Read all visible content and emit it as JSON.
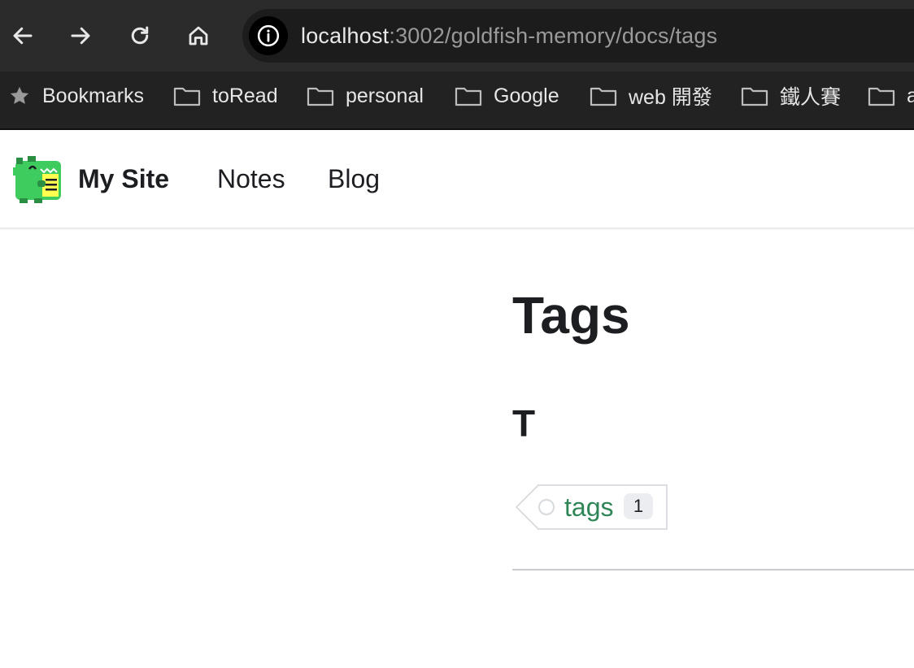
{
  "browser": {
    "url_host": "localhost",
    "url_path": ":3002/goldfish-memory/docs/tags",
    "bookmarks": [
      {
        "label": "Bookmarks",
        "icon": "star-icon"
      },
      {
        "label": "toRead",
        "icon": "folder-icon"
      },
      {
        "label": "personal",
        "icon": "folder-icon"
      },
      {
        "label": "Google",
        "icon": "folder-icon"
      },
      {
        "label": "web 開發",
        "icon": "folder-icon"
      },
      {
        "label": "鐵人賽",
        "icon": "folder-icon"
      },
      {
        "label": "a",
        "icon": "folder-icon"
      }
    ]
  },
  "navbar": {
    "brand": "My Site",
    "links": [
      "Notes",
      "Blog"
    ]
  },
  "main": {
    "title": "Tags",
    "groups": [
      {
        "letter": "T",
        "tags": [
          {
            "label": "tags",
            "count": "1"
          }
        ]
      }
    ]
  },
  "colors": {
    "tag_link": "#2e8555",
    "chrome_bg": "#2b2b2b"
  }
}
